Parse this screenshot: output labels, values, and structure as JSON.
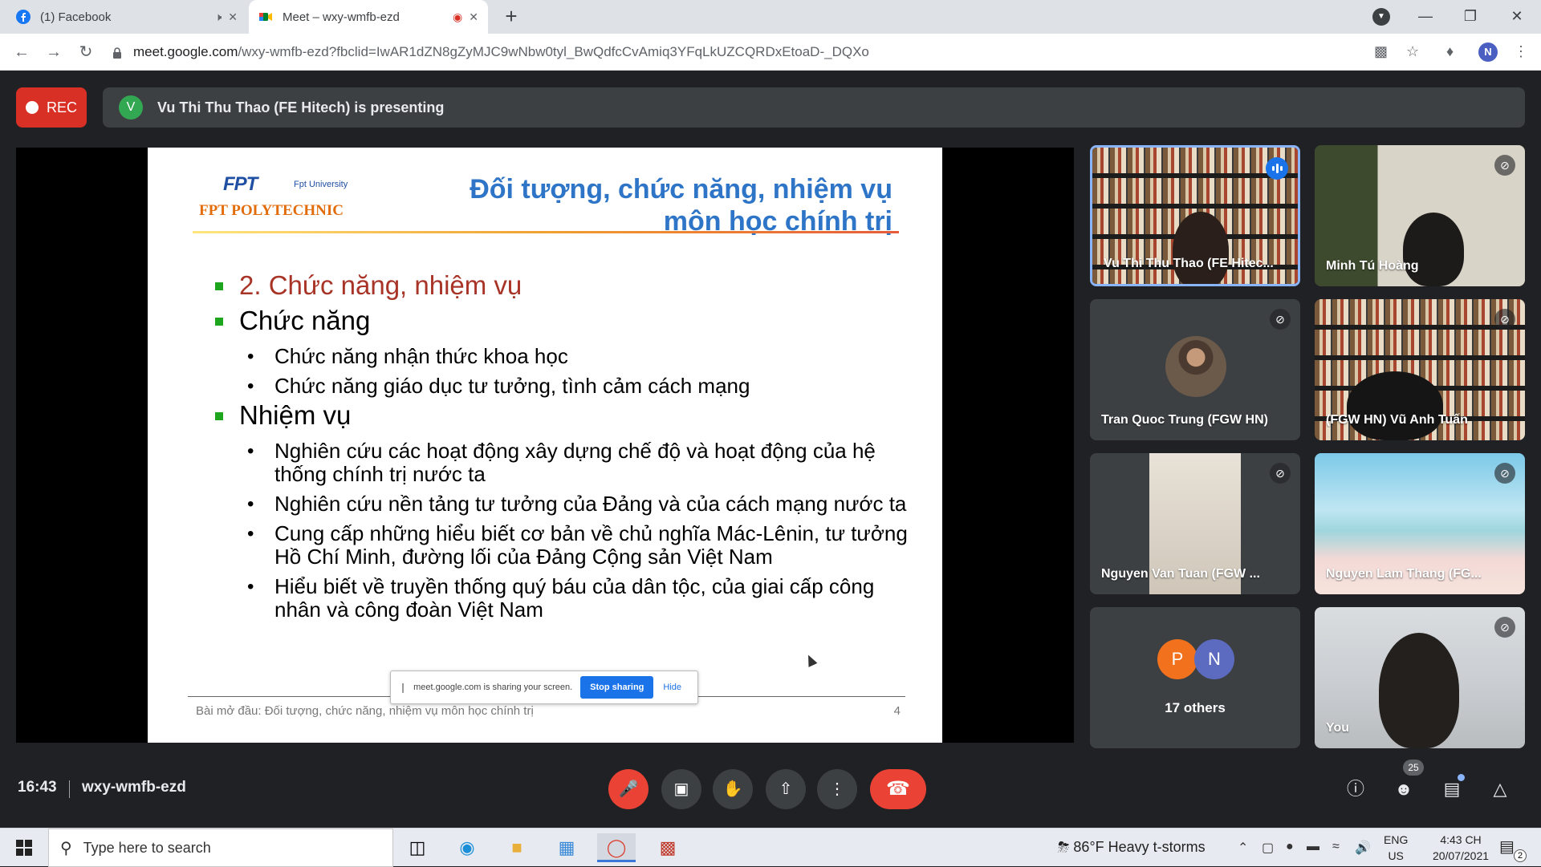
{
  "browser": {
    "tabs": [
      {
        "title": "(1) Facebook",
        "favicon": "facebook-icon",
        "extra_icon": "speaker-icon"
      },
      {
        "title": "Meet – wxy-wmfb-ezd",
        "favicon": "meet-icon",
        "extra_icon": "recording-icon"
      }
    ],
    "new_tab": "+",
    "url_host": "meet.google.com",
    "url_path": "/wxy-wmfb-ezd?fbclid=IwAR1dZN8gZyMJC9wNbw0tyl_BwQdfcCvAmiq3YFqLkUZCQRDxEtoaD-_DQXo",
    "profile_initial": "N"
  },
  "meeting": {
    "rec_label": "REC",
    "presenter_initial": "V",
    "presenting_text": "Vu Thi Thu Thao (FE Hitech) is presenting",
    "time": "16:43",
    "code": "wxy-wmfb-ezd",
    "participants_count": "25"
  },
  "slide": {
    "logo_brand": "FPT",
    "logo_university": "Fpt University",
    "logo_polytechnic": "FPT POLYTECHNIC",
    "title_line1": "Đối tượng, chức năng, nhiệm vụ",
    "title_line2": "môn học chính trị",
    "heading_section": "2. Chức năng, nhiệm vụ",
    "heading_chucnang": "Chức năng",
    "chucnang_items": [
      "Chức năng nhận thức khoa học",
      "Chức năng giáo dục tư tưởng, tình cảm cách mạng"
    ],
    "heading_nhiemvu": "Nhiệm vụ",
    "nhiemvu_items": [
      "Nghiên cứu các hoạt động xây dựng chế độ và hoạt động của hệ thống chính trị nước ta",
      "Nghiên cứu nền tảng tư tưởng của Đảng và của cách mạng nước ta",
      "Cung cấp  những hiểu biết cơ bản về chủ nghĩa Mác-Lênin, tư tưởng Hồ Chí Minh, đường lối của Đảng Cộng sản Việt Nam",
      "Hiểu biết về truyền thống quý báu của dân tộc, của giai cấp công nhân và công đoàn Việt Nam"
    ],
    "footer": "Bài mở đầu: Đối tượng, chức năng, nhiệm vụ môn học chính trị",
    "page_number": "4",
    "share_notice": "meet.google.com is sharing your screen.",
    "stop_sharing": "Stop sharing",
    "hide": "Hide"
  },
  "tiles": [
    {
      "name": "Vu Thi Thu Thao (FE Hitec...",
      "state": "speaking"
    },
    {
      "name": "Minh Tú Hoàng",
      "state": "muted"
    },
    {
      "name": "Tran Quoc Trung (FGW HN)",
      "state": "muted"
    },
    {
      "name": "(FGW HN) Vũ Anh Tuấn",
      "state": "muted"
    },
    {
      "name": "Nguyen Van Tuan (FGW ...",
      "state": "muted"
    },
    {
      "name": "Nguyen Lam Thang (FG...",
      "state": "muted"
    },
    {
      "name": "17 others",
      "avatars": [
        "P",
        "N"
      ]
    },
    {
      "name": "You",
      "state": "muted"
    }
  ],
  "taskbar": {
    "search_placeholder": "Type here to search",
    "weather_temp": "86°F",
    "weather_text": "Heavy t-storms",
    "lang_top": "ENG",
    "lang_bottom": "US",
    "time": "4:43 CH",
    "date": "20/07/2021",
    "notif_count": "2"
  },
  "colors": {
    "rec_red": "#d93025",
    "hangup_red": "#ea4335",
    "meet_bg": "#202124",
    "tile_bg": "#3c4043",
    "slide_title_blue": "#2e75c7",
    "bullet_green": "#1ea51e",
    "heading_red": "#a83428"
  }
}
